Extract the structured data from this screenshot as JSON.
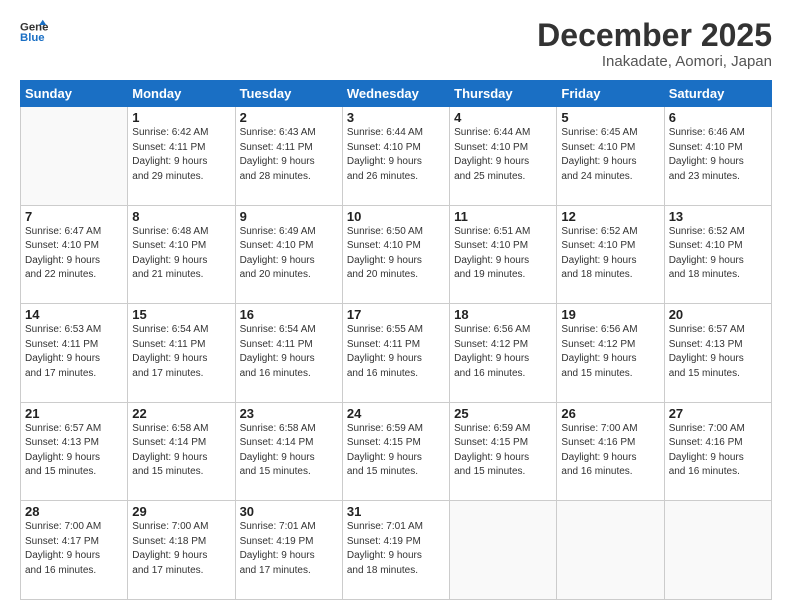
{
  "logo": {
    "line1": "General",
    "line2": "Blue"
  },
  "title": "December 2025",
  "location": "Inakadate, Aomori, Japan",
  "days_header": [
    "Sunday",
    "Monday",
    "Tuesday",
    "Wednesday",
    "Thursday",
    "Friday",
    "Saturday"
  ],
  "weeks": [
    [
      {
        "day": "",
        "info": ""
      },
      {
        "day": "1",
        "info": "Sunrise: 6:42 AM\nSunset: 4:11 PM\nDaylight: 9 hours\nand 29 minutes."
      },
      {
        "day": "2",
        "info": "Sunrise: 6:43 AM\nSunset: 4:11 PM\nDaylight: 9 hours\nand 28 minutes."
      },
      {
        "day": "3",
        "info": "Sunrise: 6:44 AM\nSunset: 4:10 PM\nDaylight: 9 hours\nand 26 minutes."
      },
      {
        "day": "4",
        "info": "Sunrise: 6:44 AM\nSunset: 4:10 PM\nDaylight: 9 hours\nand 25 minutes."
      },
      {
        "day": "5",
        "info": "Sunrise: 6:45 AM\nSunset: 4:10 PM\nDaylight: 9 hours\nand 24 minutes."
      },
      {
        "day": "6",
        "info": "Sunrise: 6:46 AM\nSunset: 4:10 PM\nDaylight: 9 hours\nand 23 minutes."
      }
    ],
    [
      {
        "day": "7",
        "info": "Sunrise: 6:47 AM\nSunset: 4:10 PM\nDaylight: 9 hours\nand 22 minutes."
      },
      {
        "day": "8",
        "info": "Sunrise: 6:48 AM\nSunset: 4:10 PM\nDaylight: 9 hours\nand 21 minutes."
      },
      {
        "day": "9",
        "info": "Sunrise: 6:49 AM\nSunset: 4:10 PM\nDaylight: 9 hours\nand 20 minutes."
      },
      {
        "day": "10",
        "info": "Sunrise: 6:50 AM\nSunset: 4:10 PM\nDaylight: 9 hours\nand 20 minutes."
      },
      {
        "day": "11",
        "info": "Sunrise: 6:51 AM\nSunset: 4:10 PM\nDaylight: 9 hours\nand 19 minutes."
      },
      {
        "day": "12",
        "info": "Sunrise: 6:52 AM\nSunset: 4:10 PM\nDaylight: 9 hours\nand 18 minutes."
      },
      {
        "day": "13",
        "info": "Sunrise: 6:52 AM\nSunset: 4:10 PM\nDaylight: 9 hours\nand 18 minutes."
      }
    ],
    [
      {
        "day": "14",
        "info": "Sunrise: 6:53 AM\nSunset: 4:11 PM\nDaylight: 9 hours\nand 17 minutes."
      },
      {
        "day": "15",
        "info": "Sunrise: 6:54 AM\nSunset: 4:11 PM\nDaylight: 9 hours\nand 17 minutes."
      },
      {
        "day": "16",
        "info": "Sunrise: 6:54 AM\nSunset: 4:11 PM\nDaylight: 9 hours\nand 16 minutes."
      },
      {
        "day": "17",
        "info": "Sunrise: 6:55 AM\nSunset: 4:11 PM\nDaylight: 9 hours\nand 16 minutes."
      },
      {
        "day": "18",
        "info": "Sunrise: 6:56 AM\nSunset: 4:12 PM\nDaylight: 9 hours\nand 16 minutes."
      },
      {
        "day": "19",
        "info": "Sunrise: 6:56 AM\nSunset: 4:12 PM\nDaylight: 9 hours\nand 15 minutes."
      },
      {
        "day": "20",
        "info": "Sunrise: 6:57 AM\nSunset: 4:13 PM\nDaylight: 9 hours\nand 15 minutes."
      }
    ],
    [
      {
        "day": "21",
        "info": "Sunrise: 6:57 AM\nSunset: 4:13 PM\nDaylight: 9 hours\nand 15 minutes."
      },
      {
        "day": "22",
        "info": "Sunrise: 6:58 AM\nSunset: 4:14 PM\nDaylight: 9 hours\nand 15 minutes."
      },
      {
        "day": "23",
        "info": "Sunrise: 6:58 AM\nSunset: 4:14 PM\nDaylight: 9 hours\nand 15 minutes."
      },
      {
        "day": "24",
        "info": "Sunrise: 6:59 AM\nSunset: 4:15 PM\nDaylight: 9 hours\nand 15 minutes."
      },
      {
        "day": "25",
        "info": "Sunrise: 6:59 AM\nSunset: 4:15 PM\nDaylight: 9 hours\nand 15 minutes."
      },
      {
        "day": "26",
        "info": "Sunrise: 7:00 AM\nSunset: 4:16 PM\nDaylight: 9 hours\nand 16 minutes."
      },
      {
        "day": "27",
        "info": "Sunrise: 7:00 AM\nSunset: 4:16 PM\nDaylight: 9 hours\nand 16 minutes."
      }
    ],
    [
      {
        "day": "28",
        "info": "Sunrise: 7:00 AM\nSunset: 4:17 PM\nDaylight: 9 hours\nand 16 minutes."
      },
      {
        "day": "29",
        "info": "Sunrise: 7:00 AM\nSunset: 4:18 PM\nDaylight: 9 hours\nand 17 minutes."
      },
      {
        "day": "30",
        "info": "Sunrise: 7:01 AM\nSunset: 4:19 PM\nDaylight: 9 hours\nand 17 minutes."
      },
      {
        "day": "31",
        "info": "Sunrise: 7:01 AM\nSunset: 4:19 PM\nDaylight: 9 hours\nand 18 minutes."
      },
      {
        "day": "",
        "info": ""
      },
      {
        "day": "",
        "info": ""
      },
      {
        "day": "",
        "info": ""
      }
    ]
  ]
}
